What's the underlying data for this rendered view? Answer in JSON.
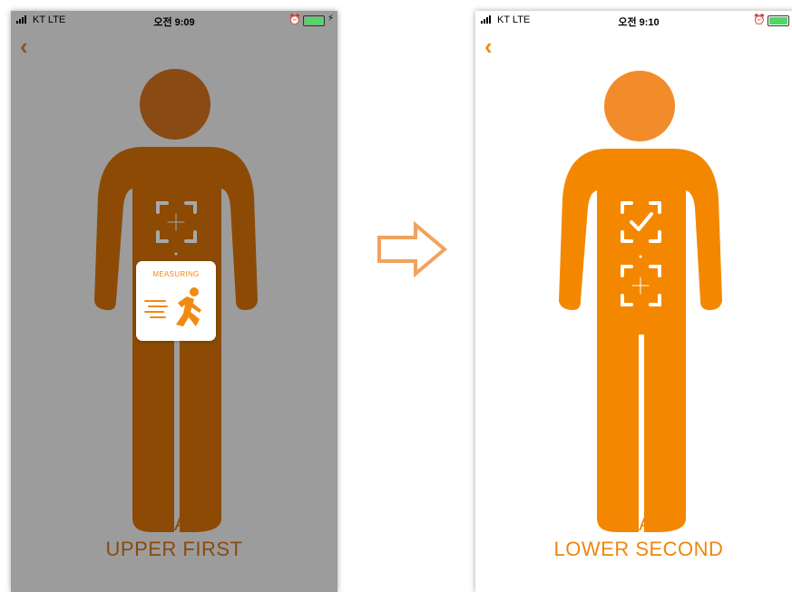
{
  "left_screen": {
    "status": {
      "carrier": "KT  LTE",
      "time": "오전 9:09"
    },
    "back_label": "‹",
    "modal_title": "MEASURING",
    "scan_line1": "SCAN",
    "scan_line2": "UPPER FIRST"
  },
  "right_screen": {
    "status": {
      "carrier": "KT  LTE",
      "time": "오전 9:10"
    },
    "back_label": "‹",
    "scan_line1": "SCAN",
    "scan_line2": "LOWER SECOND"
  },
  "icons": {
    "signal": "signal-icon",
    "alarm": "alarm-clock-icon",
    "battery": "battery-icon",
    "charging": "charging-bolt-icon",
    "back": "chevron-left-icon",
    "scan_target": "scan-target-icon",
    "scan_done": "scan-check-icon",
    "running": "running-person-icon",
    "transition": "right-arrow-icon"
  },
  "colors": {
    "left_background": "#9c9c9c",
    "left_figure": "#8c4a05",
    "left_head": "#8a4a14",
    "right_figure": "#f38800",
    "right_head": "#f28c2b",
    "accent": "#f08a12",
    "battery_fill": "#4cd964"
  }
}
